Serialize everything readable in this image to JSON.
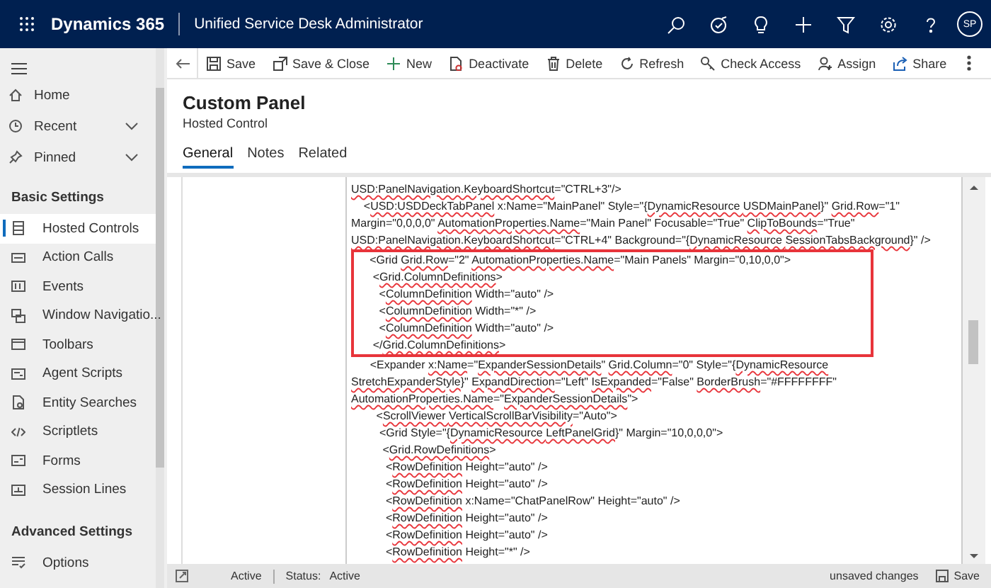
{
  "top_bar": {
    "app_name": "Dynamics 365",
    "area_name": "Unified Service Desk Administrator",
    "avatar": "SP"
  },
  "sidebar": {
    "nav": [
      {
        "label": "Home",
        "expandable": false
      },
      {
        "label": "Recent",
        "expandable": true
      },
      {
        "label": "Pinned",
        "expandable": true
      }
    ],
    "groups": [
      {
        "title": "Basic Settings",
        "items": [
          {
            "label": "Hosted Controls",
            "selected": true
          },
          {
            "label": "Action Calls",
            "selected": false
          },
          {
            "label": "Events",
            "selected": false
          },
          {
            "label": "Window Navigatio...",
            "selected": false
          },
          {
            "label": "Toolbars",
            "selected": false
          },
          {
            "label": "Agent Scripts",
            "selected": false
          },
          {
            "label": "Entity Searches",
            "selected": false
          },
          {
            "label": "Scriptlets",
            "selected": false
          },
          {
            "label": "Forms",
            "selected": false
          },
          {
            "label": "Session Lines",
            "selected": false
          }
        ]
      },
      {
        "title": "Advanced Settings",
        "items": [
          {
            "label": "Options",
            "selected": false
          }
        ]
      }
    ]
  },
  "command_bar": [
    "Save",
    "Save & Close",
    "New",
    "Deactivate",
    "Delete",
    "Refresh",
    "Check Access",
    "Assign",
    "Share"
  ],
  "record": {
    "title": "Custom Panel",
    "entity": "Hosted Control"
  },
  "tabs": [
    {
      "label": "General",
      "selected": true
    },
    {
      "label": "Notes",
      "selected": false
    },
    {
      "label": "Related",
      "selected": false
    }
  ],
  "code": {
    "blocks": [
      {
        "highlighted": false,
        "lines": [
          [
            {
              "text": "USD:PanelNavigation.KeyboardShortcut",
              "flagged": true
            },
            {
              "text": "=\"CTRL+3\"/>",
              "flagged": false
            }
          ],
          [
            {
              "text": "    <",
              "flagged": false
            },
            {
              "text": "USD:USDDeckTabPanel",
              "flagged": true
            },
            {
              "text": " x:Name=\"MainPanel\" Style=\"{",
              "flagged": false
            },
            {
              "text": "DynamicResource ",
              "flagged": true
            },
            {
              "text": "USDMainPanel",
              "flagged": true
            },
            {
              "text": "}\" ",
              "flagged": false
            },
            {
              "text": "Grid.Row",
              "flagged": true
            },
            {
              "text": "=\"1\"",
              "flagged": false
            }
          ],
          [
            {
              "text": "Margin=\"0,0,0,0\" ",
              "flagged": false
            },
            {
              "text": "AutomationProperties.Name",
              "flagged": true
            },
            {
              "text": "=\"Main Panel\" Focusable=\"True\" ",
              "flagged": false
            },
            {
              "text": "ClipToBounds",
              "flagged": true
            },
            {
              "text": "=\"True\"",
              "flagged": false
            }
          ],
          [
            {
              "text": "USD:PanelNavigation.KeyboardShortcut",
              "flagged": true
            },
            {
              "text": "=\"CTRL+4\" Background=\"{",
              "flagged": false
            },
            {
              "text": "DynamicResource ",
              "flagged": true
            },
            {
              "text": "SessionTabsBackground",
              "flagged": true
            },
            {
              "text": "}\" />",
              "flagged": false
            }
          ]
        ]
      },
      {
        "highlighted": true,
        "lines": [
          [
            {
              "text": "     <Grid ",
              "flagged": false
            },
            {
              "text": "Grid.Row",
              "flagged": true
            },
            {
              "text": "=\"2\" ",
              "flagged": false
            },
            {
              "text": "AutomationProperties.Name",
              "flagged": true
            },
            {
              "text": "=\"Main Panels\" Margin=\"0,10,0,0\">",
              "flagged": false
            }
          ],
          [
            {
              "text": "      <",
              "flagged": false
            },
            {
              "text": "Grid.ColumnDefinitions",
              "flagged": true
            },
            {
              "text": ">",
              "flagged": false
            }
          ],
          [
            {
              "text": "        <",
              "flagged": false
            },
            {
              "text": "ColumnDefinition",
              "flagged": true
            },
            {
              "text": " Width=\"auto\" />",
              "flagged": false
            }
          ],
          [
            {
              "text": "        <",
              "flagged": false
            },
            {
              "text": "ColumnDefinition",
              "flagged": true
            },
            {
              "text": " Width=\"*\" />",
              "flagged": false
            }
          ],
          [
            {
              "text": "        <",
              "flagged": false
            },
            {
              "text": "ColumnDefinition",
              "flagged": true
            },
            {
              "text": " Width=\"auto\" />",
              "flagged": false
            }
          ],
          [
            {
              "text": "      </",
              "flagged": false
            },
            {
              "text": "Grid.ColumnDefinitions",
              "flagged": true
            },
            {
              "text": ">",
              "flagged": false
            }
          ]
        ]
      },
      {
        "highlighted": false,
        "lines": [
          [
            {
              "text": "      <Expander ",
              "flagged": false
            },
            {
              "text": "x:Name",
              "flagged": true
            },
            {
              "text": "=\"",
              "flagged": false
            },
            {
              "text": "ExpanderSessionDetails",
              "flagged": true
            },
            {
              "text": "\" ",
              "flagged": false
            },
            {
              "text": "Grid.Column",
              "flagged": true
            },
            {
              "text": "=\"0\" Style=\"{",
              "flagged": false
            },
            {
              "text": "DynamicResource",
              "flagged": true
            }
          ],
          [
            {
              "text": "StretchExpanderStyle",
              "flagged": true
            },
            {
              "text": "}\" ",
              "flagged": false
            },
            {
              "text": "ExpandDirection",
              "flagged": true
            },
            {
              "text": "=\"Left\" ",
              "flagged": false
            },
            {
              "text": "IsExpanded",
              "flagged": true
            },
            {
              "text": "=\"False\" ",
              "flagged": false
            },
            {
              "text": "BorderBrush",
              "flagged": true
            },
            {
              "text": "=\"#FFFFFFFF\"",
              "flagged": false
            }
          ],
          [
            {
              "text": "AutomationProperties.Name",
              "flagged": true
            },
            {
              "text": "=\"",
              "flagged": false
            },
            {
              "text": "ExpanderSessionDetails",
              "flagged": true
            },
            {
              "text": "\">",
              "flagged": false
            }
          ],
          [
            {
              "text": "        <",
              "flagged": false
            },
            {
              "text": "ScrollViewer ",
              "flagged": true
            },
            {
              "text": "VerticalScrollBarVisibility",
              "flagged": true
            },
            {
              "text": "=\"Auto\">",
              "flagged": false
            }
          ],
          [
            {
              "text": "         <Grid Style=\"{",
              "flagged": false
            },
            {
              "text": "DynamicResource ",
              "flagged": true
            },
            {
              "text": "LeftPanelGrid",
              "flagged": true
            },
            {
              "text": "}\" Margin=\"10,0,0,0\">",
              "flagged": false
            }
          ],
          [
            {
              "text": "          <",
              "flagged": false
            },
            {
              "text": "Grid.RowDefinitions",
              "flagged": true
            },
            {
              "text": ">",
              "flagged": false
            }
          ],
          [
            {
              "text": "           <",
              "flagged": false
            },
            {
              "text": "RowDefinition",
              "flagged": true
            },
            {
              "text": " Height=\"auto\" />",
              "flagged": false
            }
          ],
          [
            {
              "text": "           <",
              "flagged": false
            },
            {
              "text": "RowDefinition",
              "flagged": true
            },
            {
              "text": " Height=\"auto\" />",
              "flagged": false
            }
          ],
          [
            {
              "text": "           <",
              "flagged": false
            },
            {
              "text": "RowDefinition",
              "flagged": true
            },
            {
              "text": " x:Name=\"ChatPanelRow\" Height=\"auto\" />",
              "flagged": false
            }
          ],
          [
            {
              "text": "           <",
              "flagged": false
            },
            {
              "text": "RowDefinition",
              "flagged": true
            },
            {
              "text": " Height=\"auto\" />",
              "flagged": false
            }
          ],
          [
            {
              "text": "           <",
              "flagged": false
            },
            {
              "text": "RowDefinition",
              "flagged": true
            },
            {
              "text": " Height=\"auto\" />",
              "flagged": false
            }
          ],
          [
            {
              "text": "           <",
              "flagged": false
            },
            {
              "text": "RowDefinition",
              "flagged": true
            },
            {
              "text": " Height=\"*\" />",
              "flagged": false
            }
          ]
        ]
      }
    ]
  },
  "status_bar": {
    "state": "Active",
    "status_label": "Status:",
    "status": "Active",
    "unsaved": "unsaved changes",
    "save": "Save"
  }
}
